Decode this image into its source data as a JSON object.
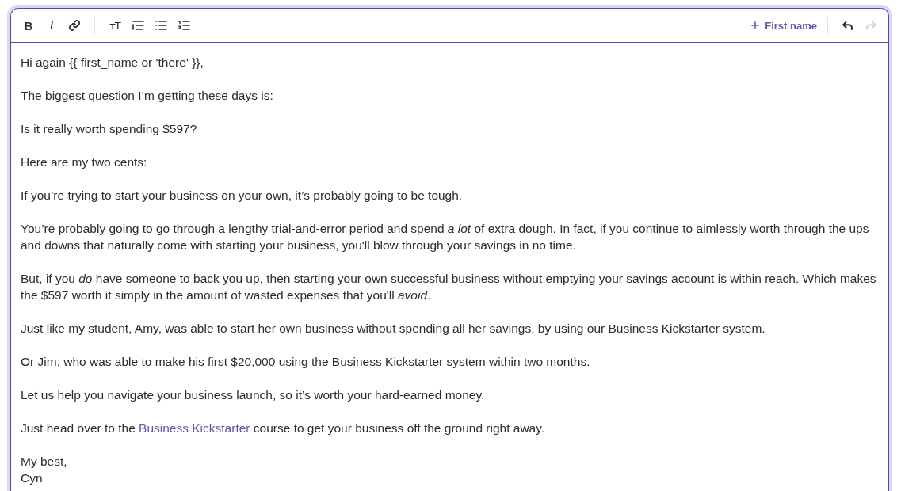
{
  "toolbar": {
    "groups": [
      {
        "buttons": [
          {
            "kind": "bold",
            "label": "B"
          },
          {
            "kind": "italic",
            "label": "I"
          },
          {
            "kind": "link"
          }
        ]
      },
      {
        "buttons": [
          {
            "kind": "text_size",
            "label": "ᴛT"
          },
          {
            "kind": "indent"
          },
          {
            "kind": "bullet_list"
          },
          {
            "kind": "numbered_list"
          }
        ]
      }
    ],
    "insert_button": {
      "label": "First name"
    },
    "history": [
      {
        "kind": "undo",
        "disabled": false
      },
      {
        "kind": "redo",
        "disabled": true
      }
    ]
  },
  "body": {
    "paragraphs": [
      {
        "kind": "text",
        "text": "Hi again {{ first_name or 'there' }},"
      },
      {
        "kind": "text",
        "text": "The biggest question I’m getting these days is:"
      },
      {
        "kind": "text",
        "text": "Is it really worth spending $597?"
      },
      {
        "kind": "text",
        "text": "Here are my two cents:"
      },
      {
        "kind": "text",
        "text": "If you’re trying to start your business on your own, it’s probably going to be tough."
      },
      {
        "kind": "text",
        "text": "You’re probably going to go through a lengthy trial-and-error period and spend *a lot* of extra dough. In fact, if you continue to aimlessly worth through the ups and downs that naturally come with starting your business, you'll blow through your savings in no time."
      },
      {
        "kind": "text",
        "text": "But, if you *do* have someone to back you up, then starting your own successful business without emptying your savings account is within reach. Which makes the $597 worth it simply in the amount of wasted expenses that you'll *avoid*."
      },
      {
        "kind": "text",
        "text": "Just like my student, Amy, was able to start her own business without spending all her savings, by using our Business Kickstarter system."
      },
      {
        "kind": "text",
        "text": "Or Jim, who was able to make his first $20,000 using the Business Kickstarter system within two months."
      },
      {
        "kind": "text",
        "text": "Let us help you navigate your business launch, so it’s worth your hard-earned money."
      },
      {
        "kind": "text_with_link",
        "parts": [
          {
            "kind": "text",
            "text": "Just head over to the "
          },
          {
            "kind": "link",
            "text": "Business Kickstarter"
          },
          {
            "kind": "text",
            "text": " course to get your business off the ground right away."
          }
        ]
      },
      {
        "kind": "sign_off",
        "lines": [
          "My best,",
          "Cyn"
        ]
      }
    ]
  }
}
